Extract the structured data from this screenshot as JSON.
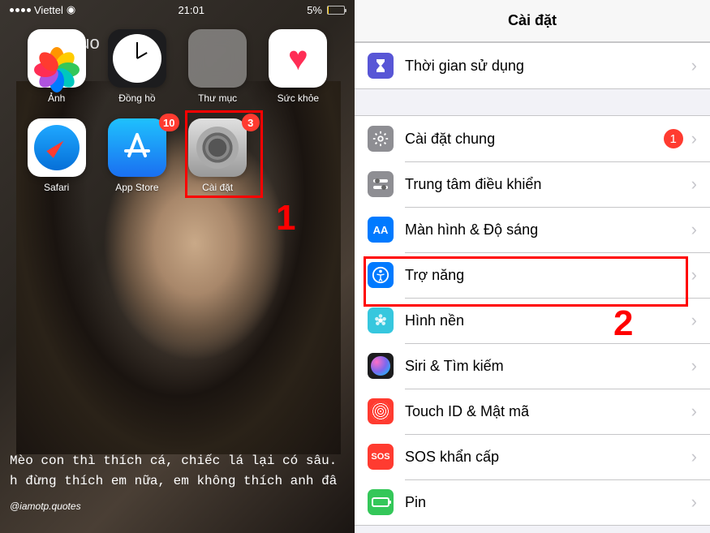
{
  "statusBar": {
    "carrier": "Viettel",
    "time": "21:01",
    "battery": "5%"
  },
  "quoText": "quo",
  "apps": {
    "photos": {
      "label": "Ảnh"
    },
    "clock": {
      "label": "Đồng hồ"
    },
    "folder": {
      "label": "Thư mục"
    },
    "health": {
      "label": "Sức khỏe"
    },
    "safari": {
      "label": "Safari"
    },
    "appstore": {
      "label": "App Store",
      "badge": "10"
    },
    "settings": {
      "label": "Cài đặt",
      "badge": "3"
    }
  },
  "wallpaper": {
    "line1": "Mèo con thì thích cá, chiếc lá lại có sâu.",
    "line2": "h đừng thích em nữa, em không thích anh đâ",
    "credit": "@iamotp.quotes"
  },
  "annotations": {
    "step1": "1",
    "step2": "2"
  },
  "settingsPage": {
    "title": "Cài đặt",
    "items": {
      "screentime": "Thời gian sử dụng",
      "general": "Cài đặt chung",
      "generalBadge": "1",
      "control": "Trung tâm điều khiển",
      "display": "Màn hình & Độ sáng",
      "displayIcon": "AA",
      "accessibility": "Trợ năng",
      "wallpaper": "Hình nền",
      "siri": "Siri & Tìm kiếm",
      "touchid": "Touch ID & Mật mã",
      "sos": "SOS khẩn cấp",
      "sosIcon": "SOS",
      "battery": "Pin"
    }
  }
}
